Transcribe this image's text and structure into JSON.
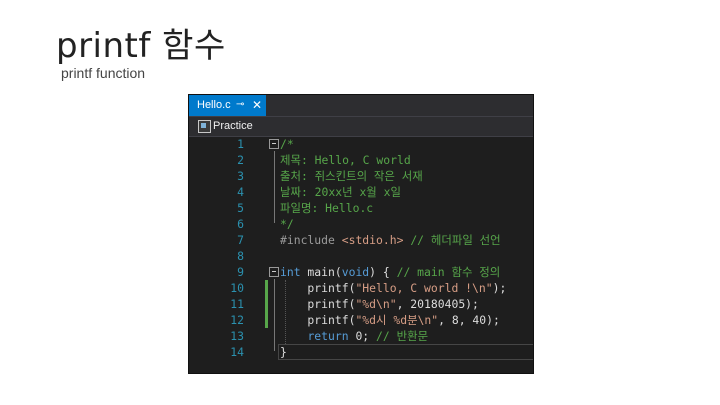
{
  "slide": {
    "title": "printf 함수",
    "subtitle": "printf function"
  },
  "ide": {
    "tab": {
      "label": "Hello.c",
      "pin": "⊸",
      "close": "✕"
    },
    "nav": {
      "project": "Practice",
      "icon": "project-icon"
    },
    "colors": {
      "background": "#1e1e1e",
      "tab_active": "#007acc",
      "comment": "#57a64a",
      "keyword": "#569cd6",
      "string": "#d69d85",
      "line_number": "#2b91af"
    },
    "lines": [
      {
        "n": "1",
        "tokens": [
          [
            "/*",
            "green"
          ]
        ]
      },
      {
        "n": "2",
        "tokens": [
          [
            "제목: Hello, C world",
            "green"
          ]
        ]
      },
      {
        "n": "3",
        "tokens": [
          [
            "출처: 쥐스킨트의 작은 서재",
            "green"
          ]
        ]
      },
      {
        "n": "4",
        "tokens": [
          [
            "날짜: 20xx년 x월 x일",
            "green"
          ]
        ]
      },
      {
        "n": "5",
        "tokens": [
          [
            "파일명: Hello.c",
            "green"
          ]
        ]
      },
      {
        "n": "6",
        "tokens": [
          [
            "*/",
            "green"
          ]
        ]
      },
      {
        "n": "7",
        "tokens": [
          [
            "#include ",
            "gray"
          ],
          [
            "<stdio.h>",
            "str"
          ],
          [
            " // 헤더파일 선언",
            "green"
          ]
        ]
      },
      {
        "n": "8",
        "tokens": []
      },
      {
        "n": "9",
        "tokens": [
          [
            "int",
            "blue"
          ],
          [
            " main(",
            "plain"
          ],
          [
            "void",
            "blue"
          ],
          [
            ") { ",
            "plain"
          ],
          [
            "// main 함수 정의",
            "green"
          ]
        ]
      },
      {
        "n": "10",
        "tokens": [
          [
            "    printf(",
            "plain"
          ],
          [
            "\"Hello, C world !\\n\"",
            "str"
          ],
          [
            ");",
            "plain"
          ]
        ]
      },
      {
        "n": "11",
        "tokens": [
          [
            "    printf(",
            "plain"
          ],
          [
            "\"%d\\n\"",
            "str"
          ],
          [
            ", 20180405);",
            "plain"
          ]
        ]
      },
      {
        "n": "12",
        "tokens": [
          [
            "    printf(",
            "plain"
          ],
          [
            "\"%d시 %d분\\n\"",
            "str"
          ],
          [
            ", 8, 40);",
            "plain"
          ]
        ]
      },
      {
        "n": "13",
        "tokens": [
          [
            "    ",
            "plain"
          ],
          [
            "return",
            "blue"
          ],
          [
            " 0; ",
            "plain"
          ],
          [
            "// 반환문",
            "green"
          ]
        ]
      },
      {
        "n": "14",
        "tokens": [
          [
            "}",
            "plain"
          ]
        ]
      }
    ]
  }
}
